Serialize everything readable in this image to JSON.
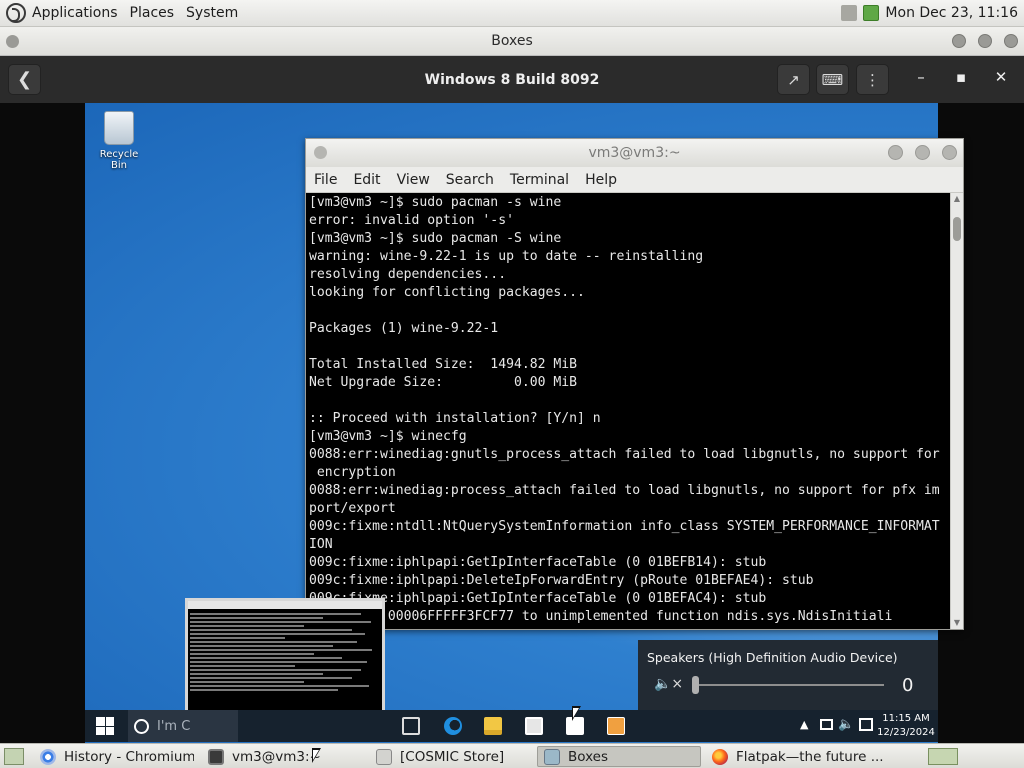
{
  "top_panel": {
    "menus": [
      "Applications",
      "Places",
      "System"
    ],
    "datetime": "Mon Dec 23, 11:16"
  },
  "boxes": {
    "window_title": "Boxes",
    "vm_name": "Windows 8 Build 8092"
  },
  "guest": {
    "desktop": {
      "recycle_bin_label": "Recycle Bin"
    },
    "terminal": {
      "title": "vm3@vm3:~",
      "menu": [
        "File",
        "Edit",
        "View",
        "Search",
        "Terminal",
        "Help"
      ],
      "lines": [
        "[vm3@vm3 ~]$ sudo pacman -s wine",
        "error: invalid option '-s'",
        "[vm3@vm3 ~]$ sudo pacman -S wine",
        "warning: wine-9.22-1 is up to date -- reinstalling",
        "resolving dependencies...",
        "looking for conflicting packages...",
        "",
        "Packages (1) wine-9.22-1",
        "",
        "Total Installed Size:  1494.82 MiB",
        "Net Upgrade Size:         0.00 MiB",
        "",
        ":: Proceed with installation? [Y/n] n",
        "[vm3@vm3 ~]$ winecfg",
        "0088:err:winediag:gnutls_process_attach failed to load libgnutls, no support for",
        " encryption",
        "0088:err:winediag:process_attach failed to load libgnutls, no support for pfx im",
        "port/export",
        "009c:fixme:ntdll:NtQuerySystemInformation info_class SYSTEM_PERFORMANCE_INFORMAT",
        "ION",
        "009c:fixme:iphlpapi:GetIpInterfaceTable (0 01BEFB14): stub",
        "009c:fixme:iphlpapi:DeleteIpForwardEntry (pRoute 01BEFAE4): stub",
        "009c:fixme:iphlpapi:GetIpInterfaceTable (0 01BEFAC4): stub",
        "     from 00006FFFFF3FCF77 to unimplemented function ndis.sys.NdisInitiali"
      ]
    },
    "volume": {
      "device": "Speakers (High Definition Audio Device)",
      "value": "0",
      "level": 0
    },
    "taskbar": {
      "search_placeholder": "I'm C",
      "clock_time": "11:15 AM",
      "clock_date": "12/23/2024"
    }
  },
  "host_taskbar": {
    "items": [
      {
        "label": "History - Chromium",
        "icon": "chromium-icon"
      },
      {
        "label": "vm3@vm3:~",
        "icon": "terminal-icon"
      },
      {
        "label": "[COSMIC Store]",
        "icon": "store-icon"
      },
      {
        "label": "Boxes",
        "icon": "boxes-icon",
        "active": true
      },
      {
        "label": "Flatpak—the future ...",
        "icon": "firefox-icon"
      }
    ]
  },
  "colors": {
    "boxes_header": "#2b2b2b",
    "win_blue": "#1c67b9",
    "taskbar_dark": "#16222e",
    "volume_flyout": "#222a33"
  }
}
